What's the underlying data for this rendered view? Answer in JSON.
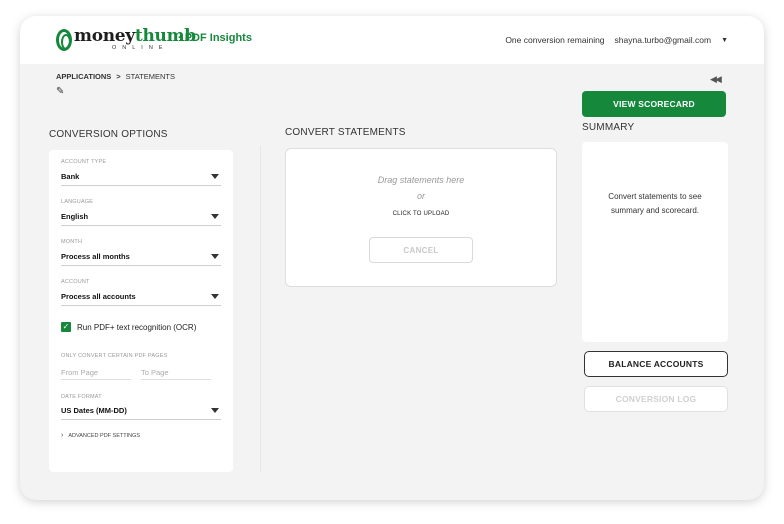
{
  "header": {
    "logo": {
      "word_dark": "money",
      "word_green": "thumb",
      "sub": "ONLINE"
    },
    "product": "· PDF Insights",
    "remaining": "One conversion remaining",
    "user_email": "shayna.turbo@gmail.com"
  },
  "breadcrumb": {
    "level1": "APPLICATIONS",
    "separator": ">",
    "level2": "STATEMENTS"
  },
  "conversion_options": {
    "title": "CONVERSION OPTIONS",
    "account_type": {
      "label": "ACCOUNT TYPE",
      "value": "Bank"
    },
    "language": {
      "label": "LANGUAGE",
      "value": "English"
    },
    "month": {
      "label": "MONTH",
      "value": "Process all months"
    },
    "account": {
      "label": "ACCOUNT",
      "value": "Process all accounts"
    },
    "ocr": {
      "label": "Run PDF+ text recognition (OCR)",
      "checked": true
    },
    "pages": {
      "label": "ONLY CONVERT CERTAIN PDF PAGES",
      "from_placeholder": "From Page",
      "to_placeholder": "To Page"
    },
    "date_format": {
      "label": "DATE FORMAT",
      "value": "US Dates (MM-DD)"
    },
    "advanced": "ADVANCED PDF SETTINGS"
  },
  "convert": {
    "title": "CONVERT STATEMENTS",
    "drag_text": "Drag statements here",
    "or_text": "or",
    "upload_text": "CLICK TO UPLOAD",
    "cancel_label": "CANCEL"
  },
  "summary": {
    "view_scorecard": "VIEW SCORECARD",
    "title": "SUMMARY",
    "message": "Convert statements to see summary and scorecard.",
    "balance_accounts": "BALANCE ACCOUNTS",
    "conversion_log": "CONVERSION LOG"
  },
  "colors": {
    "brand_green": "#16883c",
    "panel_bg": "#ffffff",
    "page_bg": "#f3f3f3"
  }
}
